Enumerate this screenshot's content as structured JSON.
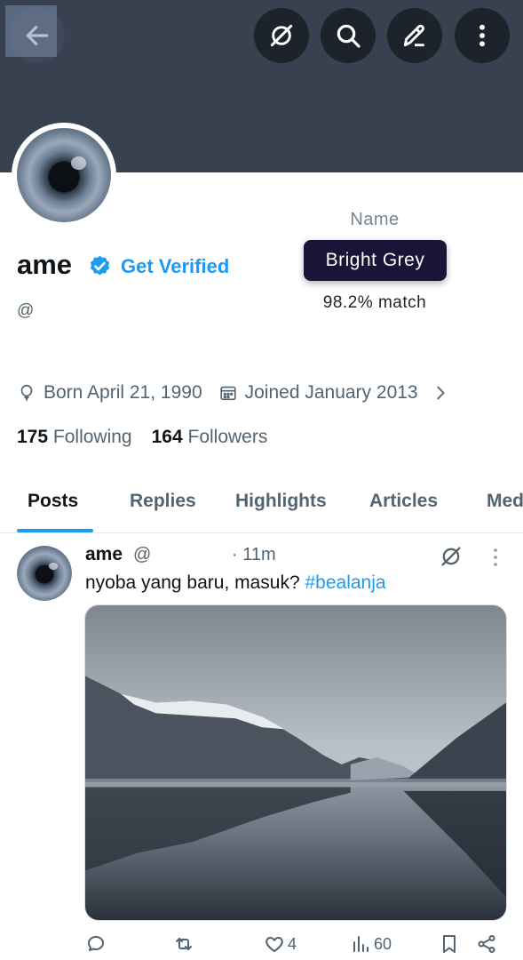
{
  "header": {
    "back_icon": "arrow-left-icon",
    "actions": [
      "grok-icon",
      "search-icon",
      "edit-icon",
      "more-vertical-icon"
    ]
  },
  "profile": {
    "display_name": "ame",
    "get_verified": "Get Verified",
    "handle": "@",
    "born": "Born April 21, 1990",
    "joined": "Joined January 2013",
    "following_count": "175",
    "following_label": "Following",
    "followers_count": "164",
    "followers_label": "Followers"
  },
  "color_overlay": {
    "label": "Name",
    "color_name": "Bright Grey",
    "match": "98.2% match"
  },
  "tabs": [
    {
      "label": "Posts",
      "active": true
    },
    {
      "label": "Replies"
    },
    {
      "label": "Highlights"
    },
    {
      "label": "Articles"
    },
    {
      "label": "Media"
    }
  ],
  "post": {
    "author": "ame",
    "handle": "@",
    "time": "· 11m",
    "text": "nyoba yang baru, masuk? ",
    "hashtag": "#bealanja",
    "likes": "4",
    "views": "60"
  },
  "colors": {
    "banner": "#37414f",
    "accent": "#1d9bf0",
    "pill": "#1a1537"
  }
}
